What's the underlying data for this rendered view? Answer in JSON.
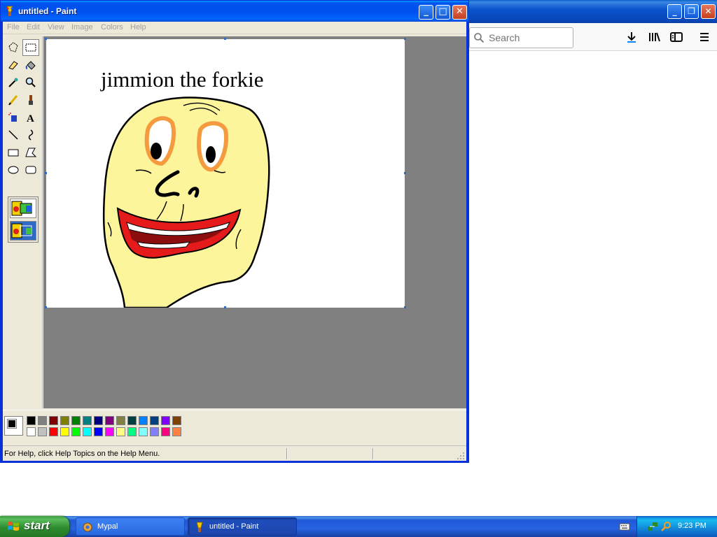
{
  "browser": {
    "search_placeholder": "Search"
  },
  "paint": {
    "title": "untitled - Paint",
    "menu": [
      "File",
      "Edit",
      "View",
      "Image",
      "Colors",
      "Help"
    ],
    "canvas_text": "jimmion the forkie",
    "status_help": "For Help, click Help Topics on the Help Menu.",
    "palette_top": [
      "#000000",
      "#808080",
      "#800000",
      "#808000",
      "#008000",
      "#008080",
      "#000080",
      "#800080",
      "#808040",
      "#004040",
      "#0080ff",
      "#004080",
      "#8000ff",
      "#804000"
    ],
    "palette_bottom": [
      "#ffffff",
      "#c0c0c0",
      "#ff0000",
      "#ffff00",
      "#00ff00",
      "#00ffff",
      "#0000ff",
      "#ff00ff",
      "#ffff80",
      "#00ff80",
      "#80ffff",
      "#8080ff",
      "#ff0080",
      "#ff8040"
    ],
    "foreground_color": "#000000",
    "background_color": "#ffffff",
    "tools": [
      "free-select",
      "rect-select",
      "eraser",
      "fill",
      "color-picker",
      "magnifier",
      "pencil",
      "brush",
      "airbrush",
      "text",
      "line",
      "curve",
      "rectangle",
      "polygon",
      "ellipse",
      "rounded-rectangle"
    ]
  },
  "taskbar": {
    "start_label": "start",
    "tasks": [
      {
        "label": "Mypal"
      },
      {
        "label": "untitled - Paint"
      }
    ],
    "clock": "9:23 PM"
  }
}
